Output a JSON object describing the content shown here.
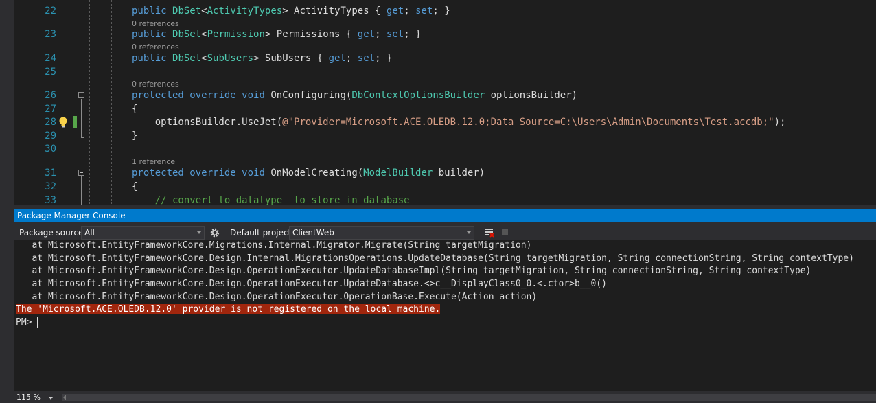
{
  "editor": {
    "lines": [
      {
        "num": "22",
        "ref": "",
        "code": [
          {
            "t": "public ",
            "c": "kw"
          },
          {
            "t": "DbSet",
            "c": "ty"
          },
          {
            "t": "<"
          },
          {
            "t": "ActivityTypes",
            "c": "ty"
          },
          {
            "t": "> ActivityTypes { "
          },
          {
            "t": "get",
            "c": "kw"
          },
          {
            "t": "; "
          },
          {
            "t": "set",
            "c": "kw"
          },
          {
            "t": "; }"
          }
        ]
      },
      {
        "num": "23",
        "ref": "0 references",
        "code": [
          {
            "t": "public ",
            "c": "kw"
          },
          {
            "t": "DbSet",
            "c": "ty"
          },
          {
            "t": "<"
          },
          {
            "t": "Permission",
            "c": "ty"
          },
          {
            "t": "> Permissions { "
          },
          {
            "t": "get",
            "c": "kw"
          },
          {
            "t": "; "
          },
          {
            "t": "set",
            "c": "kw"
          },
          {
            "t": "; }"
          }
        ]
      },
      {
        "num": "24",
        "ref": "0 references",
        "code": [
          {
            "t": "public ",
            "c": "kw"
          },
          {
            "t": "DbSet",
            "c": "ty"
          },
          {
            "t": "<"
          },
          {
            "t": "SubUsers",
            "c": "ty"
          },
          {
            "t": "> SubUsers { "
          },
          {
            "t": "get",
            "c": "kw"
          },
          {
            "t": "; "
          },
          {
            "t": "set",
            "c": "kw"
          },
          {
            "t": "; }"
          }
        ]
      },
      {
        "num": "25",
        "ref": "",
        "code": []
      },
      {
        "num": "26",
        "ref": "0 references",
        "code": [
          {
            "t": "protected ",
            "c": "kw"
          },
          {
            "t": "override ",
            "c": "kw"
          },
          {
            "t": "void ",
            "c": "kw"
          },
          {
            "t": "OnConfiguring("
          },
          {
            "t": "DbContextOptionsBuilder",
            "c": "ty"
          },
          {
            "t": " optionsBuilder)"
          }
        ]
      },
      {
        "num": "27",
        "ref": "",
        "code": [
          {
            "t": "{"
          }
        ]
      },
      {
        "num": "28",
        "ref": "",
        "code": [
          {
            "t": "    optionsBuilder.UseJet("
          },
          {
            "t": "@\"Provider=Microsoft.ACE.OLEDB.12.0;Data Source=C:\\Users\\Admin\\Documents\\Test.accdb;\"",
            "c": "st"
          },
          {
            "t": ");"
          }
        ]
      },
      {
        "num": "29",
        "ref": "",
        "code": [
          {
            "t": "}"
          }
        ]
      },
      {
        "num": "30",
        "ref": "",
        "code": []
      },
      {
        "num": "31",
        "ref": "1 reference",
        "code": [
          {
            "t": "protected ",
            "c": "kw"
          },
          {
            "t": "override ",
            "c": "kw"
          },
          {
            "t": "void ",
            "c": "kw"
          },
          {
            "t": "OnModelCreating("
          },
          {
            "t": "ModelBuilder",
            "c": "ty"
          },
          {
            "t": " builder)"
          }
        ]
      },
      {
        "num": "32",
        "ref": "",
        "code": [
          {
            "t": "{"
          }
        ]
      },
      {
        "num": "33",
        "ref": "",
        "code": [
          {
            "t": "    "
          },
          {
            "t": "// convert to datatype  to store in database",
            "c": "cm"
          }
        ]
      }
    ]
  },
  "console": {
    "title": "Package Manager Console",
    "package_source_label": "Package source:",
    "package_source_value": "All",
    "default_project_label": "Default project:",
    "default_project_value": "ClientWeb",
    "output": [
      "   at Microsoft.EntityFrameworkCore.Migrations.Internal.Migrator.Migrate(String targetMigration)",
      "   at Microsoft.EntityFrameworkCore.Design.Internal.MigrationsOperations.UpdateDatabase(String targetMigration, String connectionString, String contextType)",
      "   at Microsoft.EntityFrameworkCore.Design.OperationExecutor.UpdateDatabaseImpl(String targetMigration, String connectionString, String contextType)",
      "   at Microsoft.EntityFrameworkCore.Design.OperationExecutor.UpdateDatabase.<>c__DisplayClass0_0.<.ctor>b__0()",
      "   at Microsoft.EntityFrameworkCore.Design.OperationExecutor.OperationBase.Execute(Action action)"
    ],
    "error": "The 'Microsoft.ACE.OLEDB.12.0' provider is not registered on the local machine.",
    "prompt": "PM> "
  },
  "status": {
    "zoom": "115 %"
  },
  "colors": {
    "keyword": "#569cd6",
    "type": "#4ec9b0",
    "string": "#d69d85",
    "comment": "#57a64a",
    "error_bg": "#a1260d",
    "accent": "#007acc"
  },
  "icons": {
    "settings": "gear-icon",
    "clear": "clear-console-icon",
    "stop": "stop-icon",
    "lightbulb": "lightbulb-icon"
  }
}
